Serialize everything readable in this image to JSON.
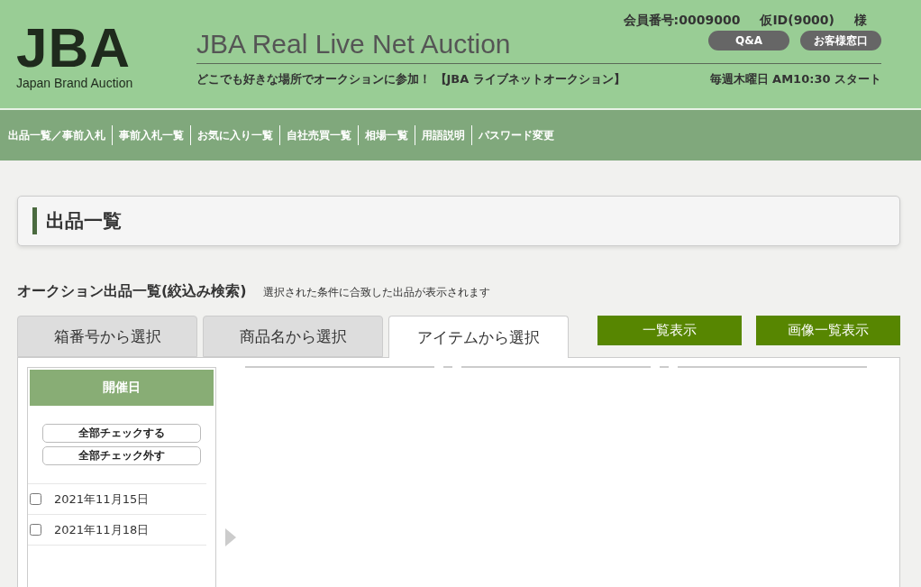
{
  "header": {
    "logo": {
      "mark": "JBA",
      "tagline": "Japan Brand Auction"
    },
    "site_title": "JBA Real Live Net Auction",
    "member": {
      "number": "会員番号:0009000",
      "temp_id": "仮ID(9000)",
      "honorific": "様"
    },
    "buttons": [
      "Q&A",
      "お客様窓口"
    ],
    "catchphrase": "どこでも好きな場所でオークションに参加！ 【JBA ライブネットオークション】",
    "schedule": "毎週木曜日 AM10:30 スタート"
  },
  "nav": [
    "出品一覧／事前入札",
    "事前入札一覧",
    "お気に入り一覧",
    "自社売買一覧",
    "相場一覧",
    "用語説明",
    "パスワード変更"
  ],
  "page_title": "出品一覧",
  "section": {
    "title": "オークション出品一覧(絞込み検索)",
    "note": "選択された条件に合致した出品が表示されます"
  },
  "tabs": [
    {
      "label": "箱番号から選択",
      "selected": false
    },
    {
      "label": "商品名から選択",
      "selected": false
    },
    {
      "label": "アイテムから選択",
      "selected": true
    }
  ],
  "view_buttons": [
    "一覧表示",
    "画像一覧表示"
  ],
  "filter": {
    "heading": "開催日",
    "actions": [
      "全部チェックする",
      "全部チェック外す"
    ],
    "dates": [
      {
        "label": "2021年11月15日",
        "checked": false
      },
      {
        "label": "2021年11月18日",
        "checked": false
      }
    ]
  }
}
